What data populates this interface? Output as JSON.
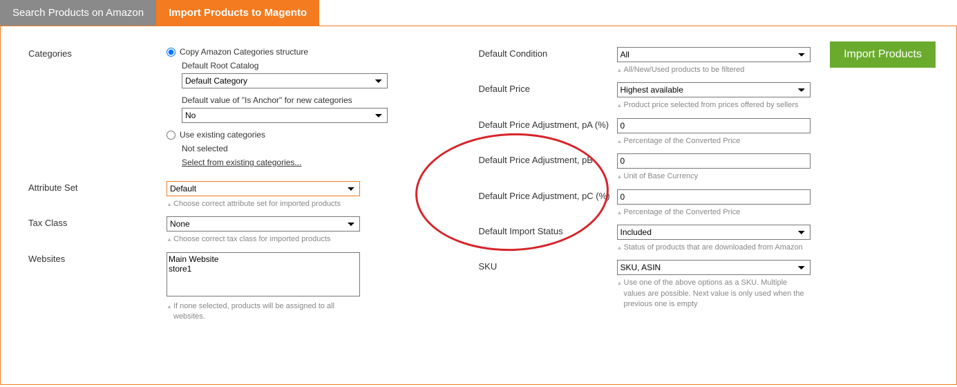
{
  "tabs": {
    "search": "Search Products on Amazon",
    "import": "Import Products to Magento"
  },
  "import_button": "Import Products",
  "left": {
    "categories": {
      "label": "Categories",
      "copy_label": "Copy Amazon Categories structure",
      "root_label": "Default Root Catalog",
      "root_value": "Default Category",
      "anchor_label": "Default value of \"Is Anchor\" for new categories",
      "anchor_value": "No",
      "use_existing_label": "Use existing categories",
      "not_selected": "Not selected",
      "select_link": "Select from existing categories..."
    },
    "attribute_set": {
      "label": "Attribute Set",
      "value": "Default",
      "hint": "Choose correct attribute set for imported products"
    },
    "tax_class": {
      "label": "Tax Class",
      "value": "None",
      "hint": "Choose correct tax class for imported products"
    },
    "websites": {
      "label": "Websites",
      "values": "Main Website\nstore1",
      "hint": "If none selected, products will be assigned to all websites."
    }
  },
  "right": {
    "condition": {
      "label": "Default Condition",
      "value": "All",
      "hint": "All/New/Used products to be filtered"
    },
    "price": {
      "label": "Default Price",
      "value": "Highest available",
      "hint": "Product price selected from prices offered by sellers"
    },
    "pA": {
      "label": "Default Price Adjustment, pA (%)",
      "value": "0",
      "hint": "Percentage of the Converted Price"
    },
    "pB": {
      "label": "Default Price Adjustment, pB",
      "value": "0",
      "hint": "Unit of Base Currency"
    },
    "pC": {
      "label": "Default Price Adjustment, pC (%)",
      "value": "0",
      "hint": "Percentage of the Converted Price"
    },
    "import_status": {
      "label": "Default Import Status",
      "value": "Included",
      "hint": "Status of products that are downloaded from Amazon"
    },
    "sku": {
      "label": "SKU",
      "value": "SKU, ASIN",
      "hint": "Use one of the above options as a SKU. Multiple values are possible. Next value is only used when the previous one is empty"
    }
  }
}
